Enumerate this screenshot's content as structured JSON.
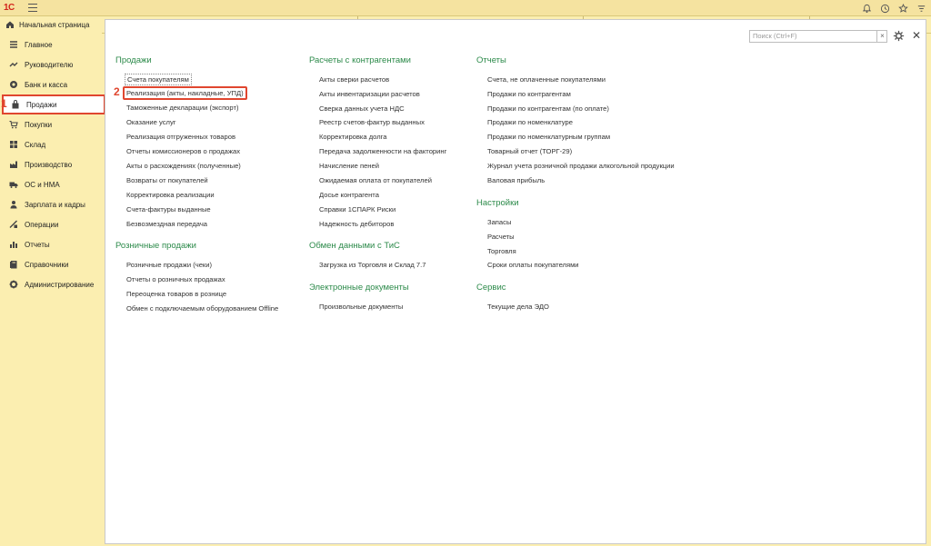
{
  "topbar": {
    "logo": "1С",
    "icons": [
      "bell-icon",
      "history-icon",
      "star-icon",
      "filter-icon"
    ]
  },
  "tabs": {
    "home_label": "Начальная страница"
  },
  "sidebar": {
    "items": [
      {
        "label": "Главное",
        "icon": "menu-lines-icon"
      },
      {
        "label": "Руководителю",
        "icon": "trend-icon"
      },
      {
        "label": "Банк и касса",
        "icon": "coin-icon"
      },
      {
        "label": "Продажи",
        "icon": "bag-icon"
      },
      {
        "label": "Покупки",
        "icon": "cart-icon"
      },
      {
        "label": "Склад",
        "icon": "warehouse-icon"
      },
      {
        "label": "Производство",
        "icon": "factory-icon"
      },
      {
        "label": "ОС и НМА",
        "icon": "truck-icon"
      },
      {
        "label": "Зарплата и кадры",
        "icon": "person-icon"
      },
      {
        "label": "Операции",
        "icon": "operations-icon"
      },
      {
        "label": "Отчеты",
        "icon": "bar-chart-icon"
      },
      {
        "label": "Справочники",
        "icon": "book-icon"
      },
      {
        "label": "Администрирование",
        "icon": "gear-icon"
      }
    ],
    "marker_1": "1"
  },
  "main": {
    "search_placeholder": "Поиск (Ctrl+F)",
    "search_clear": "×",
    "close": "✕",
    "marker_2": "2",
    "col1": {
      "sales_title": "Продажи",
      "sales_links": [
        "Счета покупателям",
        "Реализация (акты, накладные, УПД)",
        "Таможенные декларации (экспорт)",
        "Оказание услуг",
        "Реализация отгруженных товаров",
        "Отчеты комиссионеров о продажах",
        "Акты о расхождениях (полученные)",
        "Возвраты от покупателей",
        "Корректировка реализации",
        "Счета-фактуры выданные",
        "Безвозмездная передача"
      ],
      "retail_title": "Розничные продажи",
      "retail_links": [
        "Розничные продажи (чеки)",
        "Отчеты о розничных продажах",
        "Переоценка товаров в рознице",
        "Обмен с подключаемым оборудованием Offline"
      ]
    },
    "col2": {
      "settlements_title": "Расчеты с контрагентами",
      "settlements_links": [
        "Акты сверки расчетов",
        "Акты инвентаризации расчетов",
        "Сверка данных учета НДС",
        "Реестр счетов-фактур выданных",
        "Корректировка долга",
        "Передача задолженности на факторинг",
        "Начисление пеней",
        "Ожидаемая оплата от покупателей",
        "Досье контрагента",
        "Справки 1СПАРК Риски",
        "Надежность дебиторов"
      ],
      "exchange_title": "Обмен данными с ТиС",
      "exchange_links": [
        "Загрузка из Торговля и Склад 7.7"
      ],
      "edocs_title": "Электронные документы",
      "edocs_links": [
        "Произвольные документы"
      ]
    },
    "col3": {
      "reports_title": "Отчеты",
      "reports_links": [
        "Счета, не оплаченные покупателями",
        "Продажи по контрагентам",
        "Продажи по контрагентам (по оплате)",
        "Продажи по номенклатуре",
        "Продажи по номенклатурным группам",
        "Товарный отчет (ТОРГ-29)",
        "Журнал учета розничной продажи алкогольной продукции",
        "Валовая прибыль"
      ],
      "settings_title": "Настройки",
      "settings_links": [
        "Запасы",
        "Расчеты",
        "Торговля",
        "Сроки оплаты покупателями"
      ],
      "service_title": "Сервис",
      "service_links": [
        "Текущие дела ЭДО"
      ]
    }
  },
  "colors": {
    "accent_green": "#2c8a4a",
    "highlight_red": "#e0462f",
    "panel_yellow": "#fbeeb0"
  }
}
